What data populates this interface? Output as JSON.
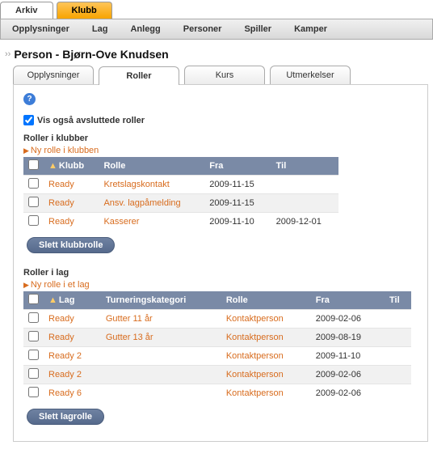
{
  "top_tabs": {
    "arkiv": "Arkiv",
    "klubb": "Klubb"
  },
  "sub_nav": [
    "Opplysninger",
    "Lag",
    "Anlegg",
    "Personer",
    "Spiller",
    "Kamper"
  ],
  "page_title": "Person - Bjørn-Ove Knudsen",
  "mid_tabs": {
    "opplysninger": "Opplysninger",
    "roller": "Roller",
    "kurs": "Kurs",
    "utmerkelser": "Utmerkelser"
  },
  "show_ended_label": "Vis også avsluttede roller",
  "club_roles": {
    "heading": "Roller i klubber",
    "new_link": "Ny rolle i klubben",
    "cols": {
      "klubb": "Klubb",
      "rolle": "Rolle",
      "fra": "Fra",
      "til": "Til"
    },
    "rows": [
      {
        "klubb": "Ready",
        "rolle": "Kretslagskontakt",
        "fra": "2009-11-15",
        "til": ""
      },
      {
        "klubb": "Ready",
        "rolle": "Ansv. lagpåmelding",
        "fra": "2009-11-15",
        "til": ""
      },
      {
        "klubb": "Ready",
        "rolle": "Kasserer",
        "fra": "2009-11-10",
        "til": "2009-12-01"
      }
    ],
    "button": "Slett klubbrolle"
  },
  "team_roles": {
    "heading": "Roller i lag",
    "new_link": "Ny rolle i et lag",
    "cols": {
      "lag": "Lag",
      "kategori": "Turneringskategori",
      "rolle": "Rolle",
      "fra": "Fra",
      "til": "Til"
    },
    "rows": [
      {
        "lag": "Ready",
        "kategori": "Gutter 11 år",
        "rolle": "Kontaktperson",
        "fra": "2009-02-06",
        "til": ""
      },
      {
        "lag": "Ready",
        "kategori": "Gutter 13 år",
        "rolle": "Kontaktperson",
        "fra": "2009-08-19",
        "til": ""
      },
      {
        "lag": "Ready 2",
        "kategori": "",
        "rolle": "Kontaktperson",
        "fra": "2009-11-10",
        "til": ""
      },
      {
        "lag": "Ready 2",
        "kategori": "",
        "rolle": "Kontaktperson",
        "fra": "2009-02-06",
        "til": ""
      },
      {
        "lag": "Ready 6",
        "kategori": "",
        "rolle": "Kontaktperson",
        "fra": "2009-02-06",
        "til": ""
      }
    ],
    "button": "Slett lagrolle"
  }
}
